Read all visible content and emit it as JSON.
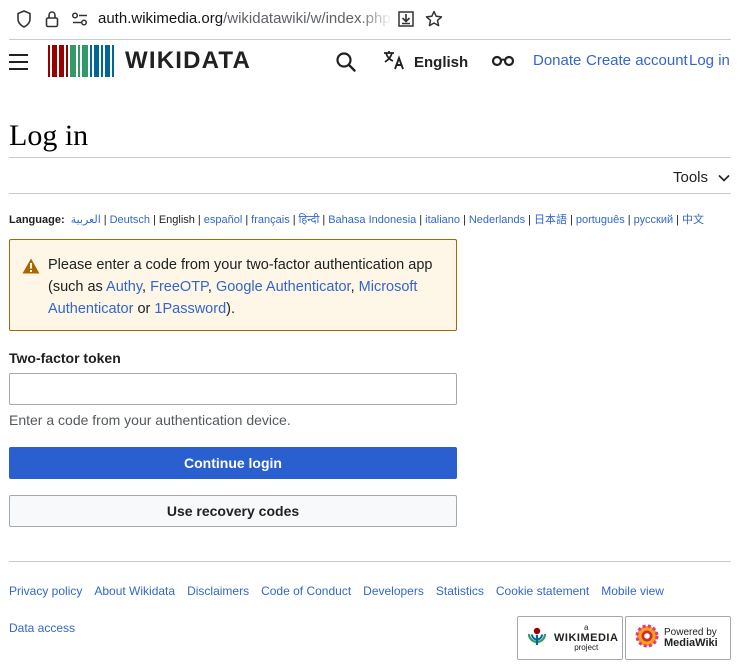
{
  "browser": {
    "url_host": "auth.wikimedia.org",
    "url_path": "/wikidatawiki/w/index.php?ti"
  },
  "header": {
    "logo_text": "WIKIDATA",
    "language_label": "English",
    "user_links": [
      "Donate",
      "Create account",
      "Log in"
    ]
  },
  "page": {
    "title": "Log in",
    "tools_label": "Tools"
  },
  "languages": {
    "prefix": "Language:",
    "items": [
      "العربية",
      "Deutsch",
      "English",
      "español",
      "français",
      "हिन्दी",
      "Bahasa Indonesia",
      "italiano",
      "Nederlands",
      "日本語",
      "português",
      "русский",
      "中文"
    ],
    "current": "English"
  },
  "notice": {
    "text_before": "Please enter a code from your two-factor authentication app (such as ",
    "apps": [
      "Authy",
      "FreeOTP",
      "Google Authenticator",
      "Microsoft Authenticator",
      "1Password"
    ],
    "text_or": " or ",
    "text_end": ")."
  },
  "form": {
    "field_label": "Two-factor token",
    "input_value": "",
    "help_text": "Enter a code from your authentication device.",
    "primary_button": "Continue login",
    "secondary_button": "Use recovery codes"
  },
  "footer": {
    "links": [
      "Privacy policy",
      "About Wikidata",
      "Disclaimers",
      "Code of Conduct",
      "Developers",
      "Statistics",
      "Cookie statement",
      "Mobile view"
    ],
    "links_row2": [
      "Data access"
    ],
    "badge_wikimedia": {
      "small": "a",
      "main": "WIKIMEDIA",
      "sub": "project"
    },
    "badge_mediawiki": {
      "small": "Powered by",
      "main": "MediaWiki"
    }
  },
  "colors": {
    "link": "#3366cc",
    "primary_button": "#2a5fcf",
    "warning_bg": "#fef6e7",
    "warning_border": "#ac6600"
  }
}
